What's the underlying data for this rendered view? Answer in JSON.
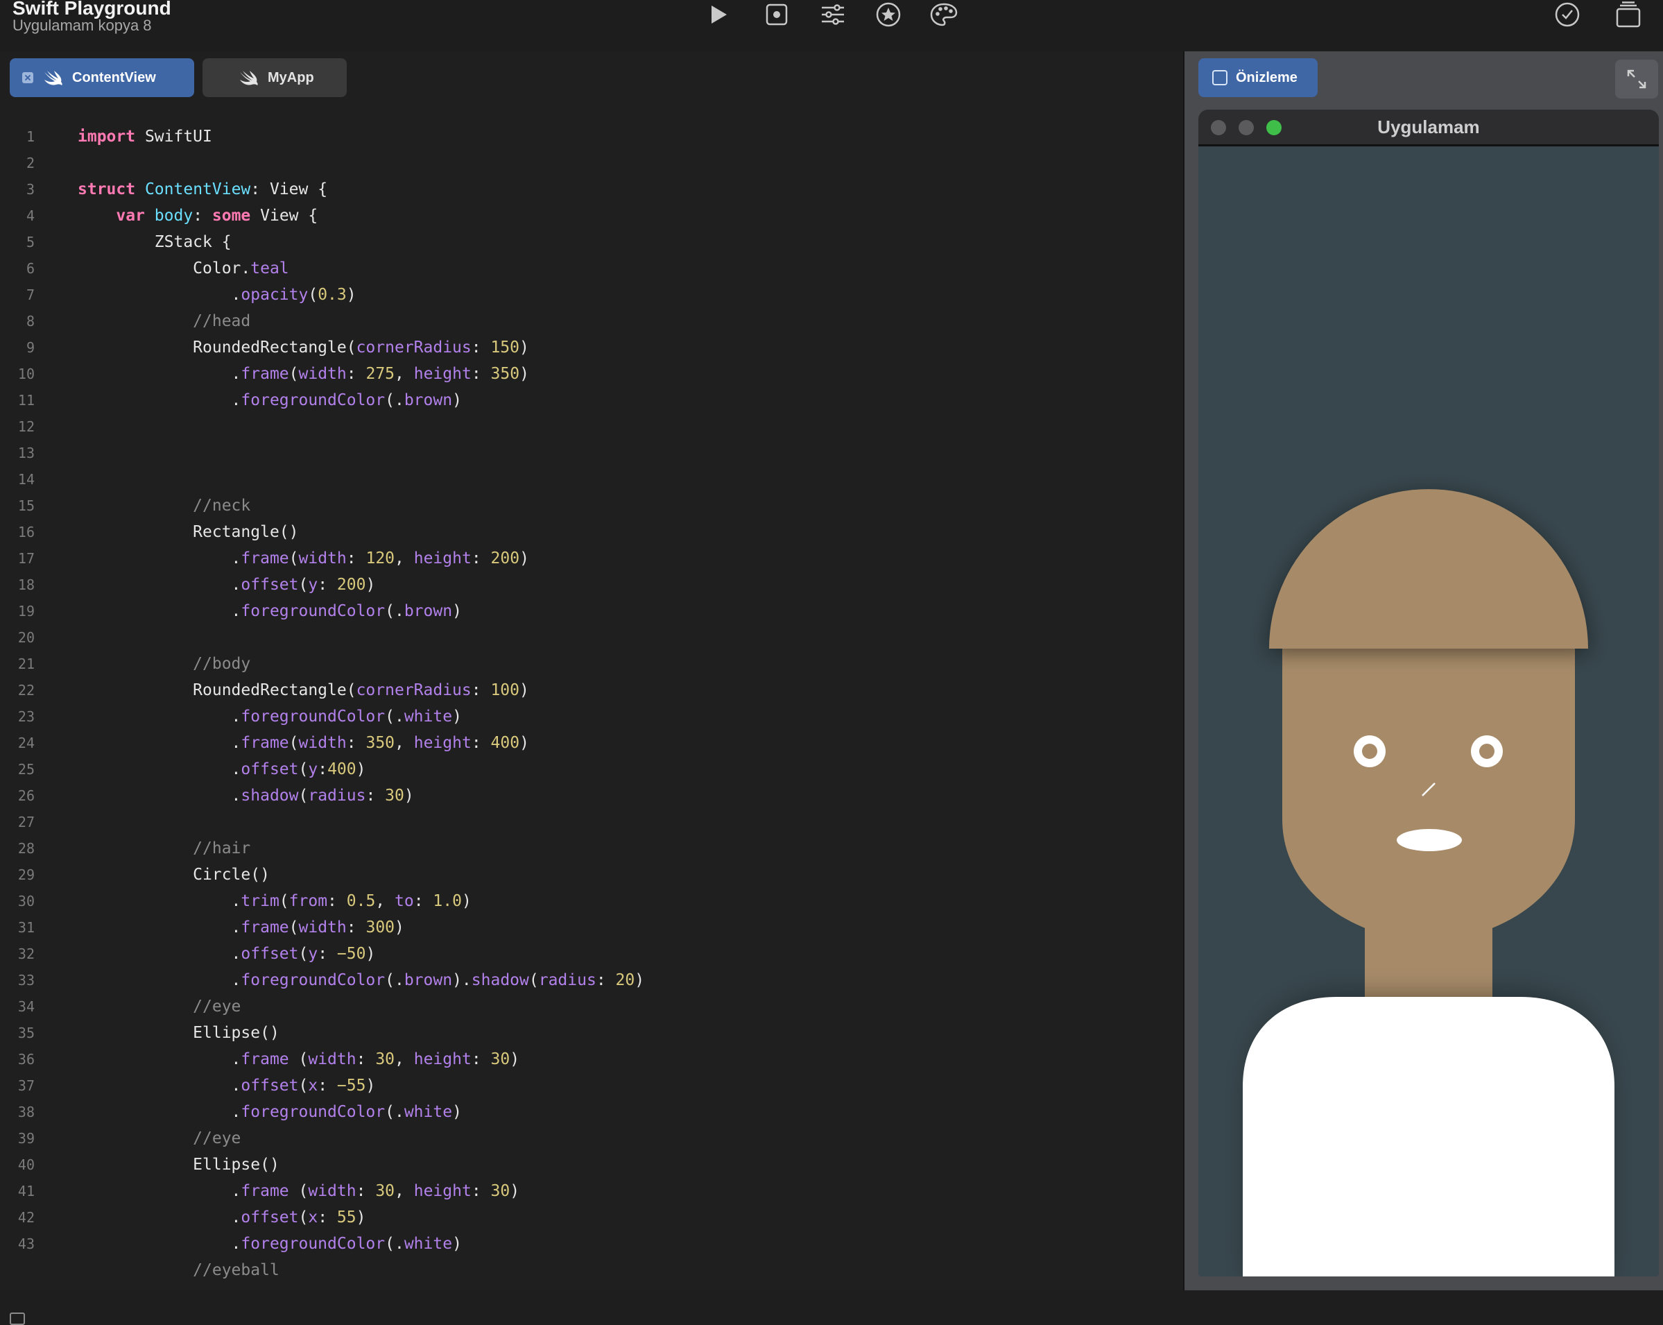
{
  "toolbar": {
    "title": "Swift Playground",
    "subtitle": "Uygulamam kopya 8",
    "buttons": [
      "play-icon",
      "stop-icon",
      "sliders-icon",
      "star-icon",
      "palette-icon",
      "checkmark-icon",
      "library-icon"
    ]
  },
  "tabs": [
    {
      "label": "ContentView",
      "active": true
    },
    {
      "label": "MyApp",
      "active": false
    }
  ],
  "code": {
    "line_numbers": [
      "1",
      "2",
      "3",
      "4",
      "5",
      "6",
      "7",
      "8",
      "9",
      "10",
      "11",
      "12",
      "13",
      "14",
      "15",
      "16",
      "17",
      "18",
      "19",
      "20",
      "21",
      "22",
      "23",
      "24",
      "25",
      "26",
      "27",
      "28",
      "29",
      "30",
      "31",
      "32",
      "33",
      "34",
      "35",
      "36",
      "37",
      "38",
      "39",
      "40",
      "41",
      "42",
      "43"
    ],
    "lines": [
      [
        [
          "kw",
          "import"
        ],
        [
          "pl",
          " SwiftUI"
        ]
      ],
      [],
      [
        [
          "kw",
          "struct"
        ],
        [
          "pl",
          " "
        ],
        [
          "ty",
          "ContentView"
        ],
        [
          "pl",
          ": View {"
        ]
      ],
      [
        [
          "pl",
          "    "
        ],
        [
          "kw",
          "var"
        ],
        [
          "pl",
          " "
        ],
        [
          "ty",
          "body"
        ],
        [
          "pl",
          ": "
        ],
        [
          "kw",
          "some"
        ],
        [
          "pl",
          " View {"
        ]
      ],
      [
        [
          "pl",
          "        ZStack {"
        ]
      ],
      [
        [
          "pl",
          "            Color."
        ],
        [
          "fn",
          "teal"
        ]
      ],
      [
        [
          "pl",
          "                ."
        ],
        [
          "fn",
          "opacity"
        ],
        [
          "pl",
          "("
        ],
        [
          "num",
          "0.3"
        ],
        [
          "pl",
          ")"
        ]
      ],
      [
        [
          "pl",
          "            "
        ],
        [
          "cm",
          "//head"
        ]
      ],
      [
        [
          "pl",
          "            RoundedRectangle("
        ],
        [
          "fn",
          "cornerRadius"
        ],
        [
          "pl",
          ": "
        ],
        [
          "num",
          "150"
        ],
        [
          "pl",
          ")"
        ]
      ],
      [
        [
          "pl",
          "                ."
        ],
        [
          "fn",
          "frame"
        ],
        [
          "pl",
          "("
        ],
        [
          "fn",
          "width"
        ],
        [
          "pl",
          ": "
        ],
        [
          "num",
          "275"
        ],
        [
          "pl",
          ", "
        ],
        [
          "fn",
          "height"
        ],
        [
          "pl",
          ": "
        ],
        [
          "num",
          "350"
        ],
        [
          "pl",
          ")"
        ]
      ],
      [
        [
          "pl",
          "                ."
        ],
        [
          "fn",
          "foregroundColor"
        ],
        [
          "pl",
          "(."
        ],
        [
          "fn",
          "brown"
        ],
        [
          "pl",
          ")"
        ]
      ],
      [],
      [],
      [],
      [
        [
          "pl",
          "            "
        ],
        [
          "cm",
          "//neck"
        ]
      ],
      [
        [
          "pl",
          "            Rectangle()"
        ]
      ],
      [
        [
          "pl",
          "                ."
        ],
        [
          "fn",
          "frame"
        ],
        [
          "pl",
          "("
        ],
        [
          "fn",
          "width"
        ],
        [
          "pl",
          ": "
        ],
        [
          "num",
          "120"
        ],
        [
          "pl",
          ", "
        ],
        [
          "fn",
          "height"
        ],
        [
          "pl",
          ": "
        ],
        [
          "num",
          "200"
        ],
        [
          "pl",
          ")"
        ]
      ],
      [
        [
          "pl",
          "                ."
        ],
        [
          "fn",
          "offset"
        ],
        [
          "pl",
          "("
        ],
        [
          "fn",
          "y"
        ],
        [
          "pl",
          ": "
        ],
        [
          "num",
          "200"
        ],
        [
          "pl",
          ")"
        ]
      ],
      [
        [
          "pl",
          "                ."
        ],
        [
          "fn",
          "foregroundColor"
        ],
        [
          "pl",
          "(."
        ],
        [
          "fn",
          "brown"
        ],
        [
          "pl",
          ")"
        ]
      ],
      [],
      [
        [
          "pl",
          "            "
        ],
        [
          "cm",
          "//body"
        ]
      ],
      [
        [
          "pl",
          "            RoundedRectangle("
        ],
        [
          "fn",
          "cornerRadius"
        ],
        [
          "pl",
          ": "
        ],
        [
          "num",
          "100"
        ],
        [
          "pl",
          ")"
        ]
      ],
      [
        [
          "pl",
          "                ."
        ],
        [
          "fn",
          "foregroundColor"
        ],
        [
          "pl",
          "(."
        ],
        [
          "fn",
          "white"
        ],
        [
          "pl",
          ")"
        ]
      ],
      [
        [
          "pl",
          "                ."
        ],
        [
          "fn",
          "frame"
        ],
        [
          "pl",
          "("
        ],
        [
          "fn",
          "width"
        ],
        [
          "pl",
          ": "
        ],
        [
          "num",
          "350"
        ],
        [
          "pl",
          ", "
        ],
        [
          "fn",
          "height"
        ],
        [
          "pl",
          ": "
        ],
        [
          "num",
          "400"
        ],
        [
          "pl",
          ")"
        ]
      ],
      [
        [
          "pl",
          "                ."
        ],
        [
          "fn",
          "offset"
        ],
        [
          "pl",
          "("
        ],
        [
          "fn",
          "y"
        ],
        [
          "pl",
          ":"
        ],
        [
          "num",
          "400"
        ],
        [
          "pl",
          ")"
        ]
      ],
      [
        [
          "pl",
          "                ."
        ],
        [
          "fn",
          "shadow"
        ],
        [
          "pl",
          "("
        ],
        [
          "fn",
          "radius"
        ],
        [
          "pl",
          ": "
        ],
        [
          "num",
          "30"
        ],
        [
          "pl",
          ")"
        ]
      ],
      [],
      [
        [
          "pl",
          "            "
        ],
        [
          "cm",
          "//hair"
        ]
      ],
      [
        [
          "pl",
          "            Circle()"
        ]
      ],
      [
        [
          "pl",
          "                ."
        ],
        [
          "fn",
          "trim"
        ],
        [
          "pl",
          "("
        ],
        [
          "fn",
          "from"
        ],
        [
          "pl",
          ": "
        ],
        [
          "num",
          "0.5"
        ],
        [
          "pl",
          ", "
        ],
        [
          "fn",
          "to"
        ],
        [
          "pl",
          ": "
        ],
        [
          "num",
          "1.0"
        ],
        [
          "pl",
          ")"
        ]
      ],
      [
        [
          "pl",
          "                ."
        ],
        [
          "fn",
          "frame"
        ],
        [
          "pl",
          "("
        ],
        [
          "fn",
          "width"
        ],
        [
          "pl",
          ": "
        ],
        [
          "num",
          "300"
        ],
        [
          "pl",
          ")"
        ]
      ],
      [
        [
          "pl",
          "                ."
        ],
        [
          "fn",
          "offset"
        ],
        [
          "pl",
          "("
        ],
        [
          "fn",
          "y"
        ],
        [
          "pl",
          ": "
        ],
        [
          "num",
          "−50"
        ],
        [
          "pl",
          ")"
        ]
      ],
      [
        [
          "pl",
          "                ."
        ],
        [
          "fn",
          "foregroundColor"
        ],
        [
          "pl",
          "(."
        ],
        [
          "fn",
          "brown"
        ],
        [
          "pl",
          ")."
        ],
        [
          "fn",
          "shadow"
        ],
        [
          "pl",
          "("
        ],
        [
          "fn",
          "radius"
        ],
        [
          "pl",
          ": "
        ],
        [
          "num",
          "20"
        ],
        [
          "pl",
          ")"
        ]
      ],
      [
        [
          "pl",
          "            "
        ],
        [
          "cm",
          "//eye"
        ]
      ],
      [
        [
          "pl",
          "            Ellipse()"
        ]
      ],
      [
        [
          "pl",
          "                ."
        ],
        [
          "fn",
          "frame"
        ],
        [
          "pl",
          " ("
        ],
        [
          "fn",
          "width"
        ],
        [
          "pl",
          ": "
        ],
        [
          "num",
          "30"
        ],
        [
          "pl",
          ", "
        ],
        [
          "fn",
          "height"
        ],
        [
          "pl",
          ": "
        ],
        [
          "num",
          "30"
        ],
        [
          "pl",
          ")"
        ]
      ],
      [
        [
          "pl",
          "                ."
        ],
        [
          "fn",
          "offset"
        ],
        [
          "pl",
          "("
        ],
        [
          "fn",
          "x"
        ],
        [
          "pl",
          ": "
        ],
        [
          "num",
          "−55"
        ],
        [
          "pl",
          ")"
        ]
      ],
      [
        [
          "pl",
          "                ."
        ],
        [
          "fn",
          "foregroundColor"
        ],
        [
          "pl",
          "(."
        ],
        [
          "fn",
          "white"
        ],
        [
          "pl",
          ")"
        ]
      ],
      [
        [
          "pl",
          "            "
        ],
        [
          "cm",
          "//eye"
        ]
      ],
      [
        [
          "pl",
          "            Ellipse()"
        ]
      ],
      [
        [
          "pl",
          "                ."
        ],
        [
          "fn",
          "frame"
        ],
        [
          "pl",
          " ("
        ],
        [
          "fn",
          "width"
        ],
        [
          "pl",
          ": "
        ],
        [
          "num",
          "30"
        ],
        [
          "pl",
          ", "
        ],
        [
          "fn",
          "height"
        ],
        [
          "pl",
          ": "
        ],
        [
          "num",
          "30"
        ],
        [
          "pl",
          ")"
        ]
      ],
      [
        [
          "pl",
          "                ."
        ],
        [
          "fn",
          "offset"
        ],
        [
          "pl",
          "("
        ],
        [
          "fn",
          "x"
        ],
        [
          "pl",
          ": "
        ],
        [
          "num",
          "55"
        ],
        [
          "pl",
          ")"
        ]
      ],
      [
        [
          "pl",
          "                ."
        ],
        [
          "fn",
          "foregroundColor"
        ],
        [
          "pl",
          "(."
        ],
        [
          "fn",
          "white"
        ],
        [
          "pl",
          ")"
        ]
      ],
      [
        [
          "pl",
          "            "
        ],
        [
          "cm",
          "//eyeball"
        ]
      ]
    ]
  },
  "preview": {
    "tab_label": "Önizleme",
    "window_title": "Uygulamam",
    "colors": {
      "background": "#38474d",
      "skin": "#a78b69",
      "body": "#ffffff",
      "eye": "#ffffff"
    }
  },
  "colors": {
    "keyword": "#ff7ab2",
    "type": "#6bdfff",
    "function": "#b281eb",
    "number": "#d9c97c",
    "comment": "#8b8b8b",
    "accent": "#3f67a6"
  }
}
